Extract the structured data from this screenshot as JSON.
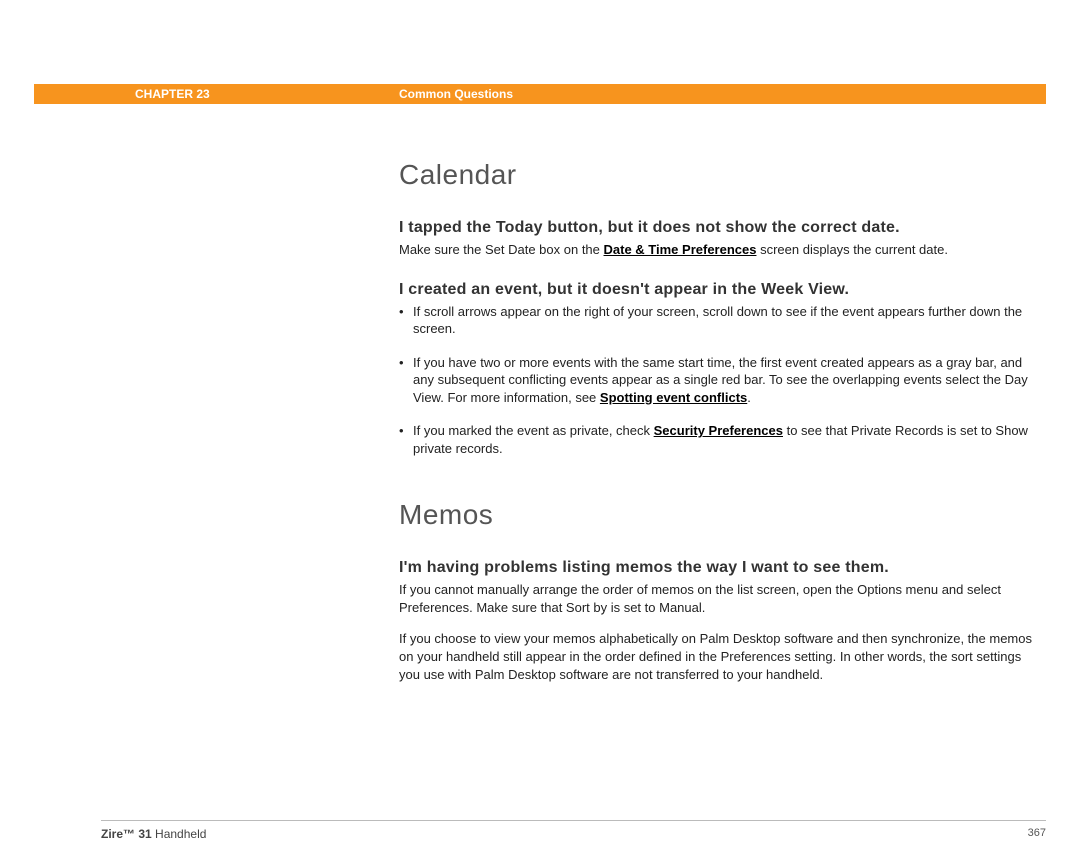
{
  "header": {
    "chapter": "CHAPTER 23",
    "section": "Common Questions"
  },
  "sections": [
    {
      "title": "Calendar",
      "qa": [
        {
          "q": "I tapped the Today button, but it does not show the correct date.",
          "body_pre": "Make sure the Set Date box on the ",
          "link": "Date & Time Preferences",
          "body_post": " screen displays the current date."
        },
        {
          "q": "I created an event, but it doesn't appear in the Week View.",
          "bullets": [
            {
              "pre": "If scroll arrows appear on the right of your screen, scroll down to see if the event appears further down the screen.",
              "link": "",
              "post": ""
            },
            {
              "pre": "If you have two or more events with the same start time, the first event created appears as a gray bar, and any subsequent conflicting events appear as a single red bar. To see the overlapping events select the Day View. For more information, see ",
              "link": "Spotting event conflicts",
              "post": "."
            },
            {
              "pre": "If you marked the event as private, check ",
              "link": "Security Preferences",
              "post": " to see that Private Records is set to Show private records."
            }
          ]
        }
      ]
    },
    {
      "title": "Memos",
      "qa": [
        {
          "q": "I'm having problems listing memos the way I want to see them.",
          "paras": [
            "If you cannot manually arrange the order of memos on the list screen, open the Options menu and select Preferences. Make sure that Sort by is set to Manual.",
            "If you choose to view your memos alphabetically on Palm Desktop software and then synchronize, the memos on your handheld still appear in the order defined in the Preferences setting. In other words, the sort settings you use with Palm Desktop software are not transferred to your handheld."
          ]
        }
      ]
    }
  ],
  "footer": {
    "product_bold": "Zire™ 31",
    "product_rest": " Handheld",
    "page": "367"
  }
}
